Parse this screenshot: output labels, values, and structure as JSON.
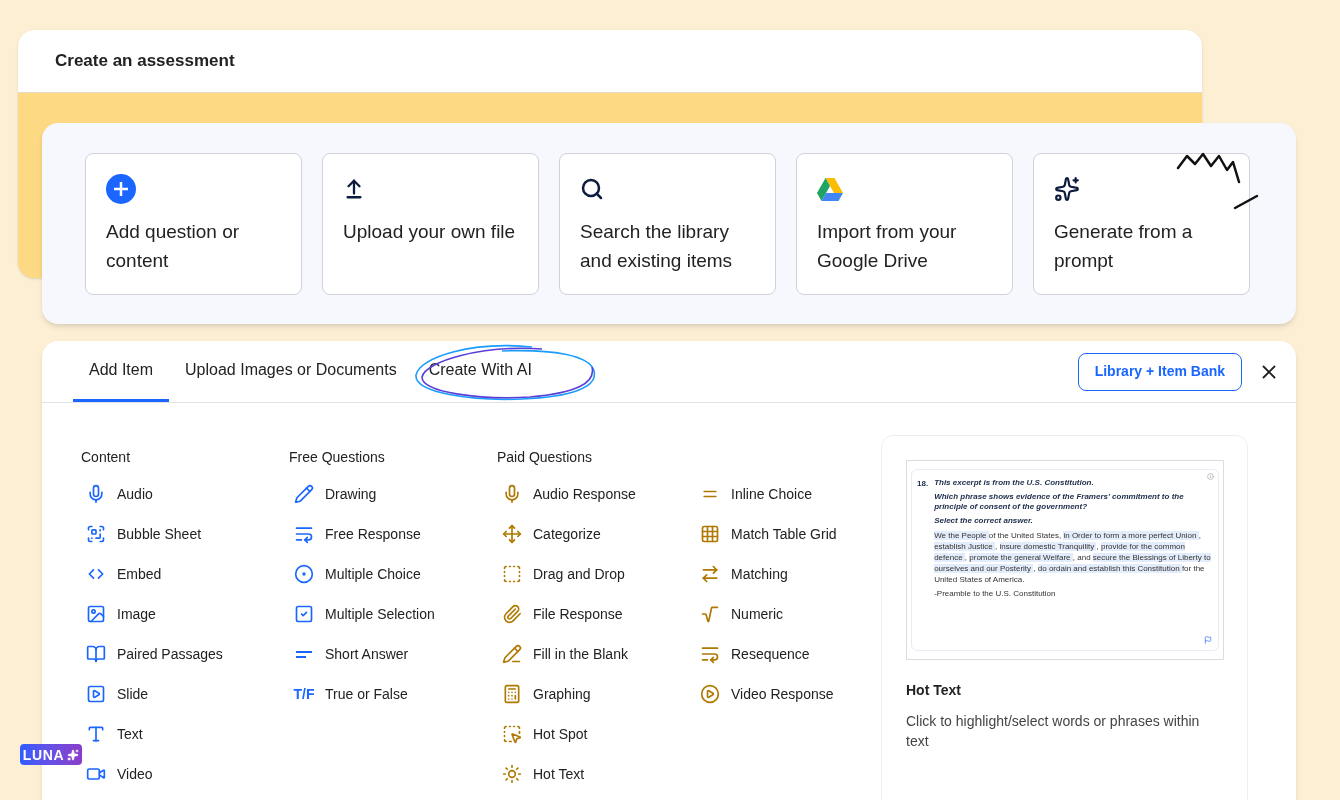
{
  "back_window": {
    "title": "Create an assessment"
  },
  "add_options": [
    {
      "label": "Add question or content"
    },
    {
      "label": "Upload your own file"
    },
    {
      "label": "Search the library and existing items"
    },
    {
      "label": "Import from your Google Drive"
    },
    {
      "label": "Generate from a prompt"
    }
  ],
  "tabs": [
    {
      "label": "Add Item",
      "selected": true
    },
    {
      "label": "Upload Images or Documents",
      "selected": false
    },
    {
      "label": "Create With AI",
      "selected": false
    }
  ],
  "library_button": "Library + Item Bank",
  "sections": [
    {
      "heading": "Content",
      "paid": false,
      "items": [
        {
          "label": "Audio"
        },
        {
          "label": "Bubble Sheet"
        },
        {
          "label": "Embed"
        },
        {
          "label": "Image"
        },
        {
          "label": "Paired Passages"
        },
        {
          "label": "Slide"
        },
        {
          "label": "Text"
        },
        {
          "label": "Video"
        }
      ]
    },
    {
      "heading": "Free Questions",
      "paid": false,
      "items": [
        {
          "label": "Drawing"
        },
        {
          "label": "Free Response"
        },
        {
          "label": "Multiple Choice"
        },
        {
          "label": "Multiple Selection"
        },
        {
          "label": "Short Answer"
        },
        {
          "label": "True or False",
          "icon_text": "T/F"
        }
      ]
    },
    {
      "heading": "Paid Questions",
      "paid": true,
      "items": [
        {
          "label": "Audio Response"
        },
        {
          "label": "Categorize"
        },
        {
          "label": "Drag and Drop"
        },
        {
          "label": "File Response"
        },
        {
          "label": "Fill in the Blank"
        },
        {
          "label": "Graphing"
        },
        {
          "label": "Hot Spot"
        },
        {
          "label": "Hot Text"
        }
      ]
    },
    {
      "paid": true,
      "items": [
        {
          "label": "Inline Choice"
        },
        {
          "label": "Match Table Grid"
        },
        {
          "label": "Matching"
        },
        {
          "label": "Numeric"
        },
        {
          "label": "Resequence"
        },
        {
          "label": "Video Response"
        }
      ]
    }
  ],
  "preview": {
    "number": "18.",
    "prompts": [
      "This excerpt is from the U.S. Constitution.",
      "Which phrase shows evidence of the Framers' commitment to the principle of consent of the government?",
      "Select the correct answer."
    ],
    "passage": [
      {
        "text": "We the People",
        "highlighted": true
      },
      {
        "text": "of the United States,",
        "highlighted": false
      },
      {
        "text": "in Order to form a more perfect Union",
        "highlighted": true
      },
      {
        "text": ",",
        "highlighted": false
      },
      {
        "text": "establish Justice",
        "highlighted": true
      },
      {
        "text": ",",
        "highlighted": false
      },
      {
        "text": "insure domestic Tranquility",
        "highlighted": true
      },
      {
        "text": ",",
        "highlighted": false
      },
      {
        "text": "provide for the common defence",
        "highlighted": true
      },
      {
        "text": ",",
        "highlighted": false
      },
      {
        "text": "promote the general Welfare",
        "highlighted": true
      },
      {
        "text": ", and",
        "highlighted": false
      },
      {
        "text": "secure the Blessings of Liberty to ourselves and our Posterity",
        "highlighted": true
      },
      {
        "text": ",",
        "highlighted": false
      },
      {
        "text": "do ordain and establish this Constitution",
        "highlighted": true
      },
      {
        "text": "for the United States of America.",
        "highlighted": false
      }
    ],
    "source": "-Preamble to the U.S. Constitution",
    "title": "Hot Text",
    "description": "Click to highlight/select words or phrases within text"
  },
  "badge": "LUNA"
}
